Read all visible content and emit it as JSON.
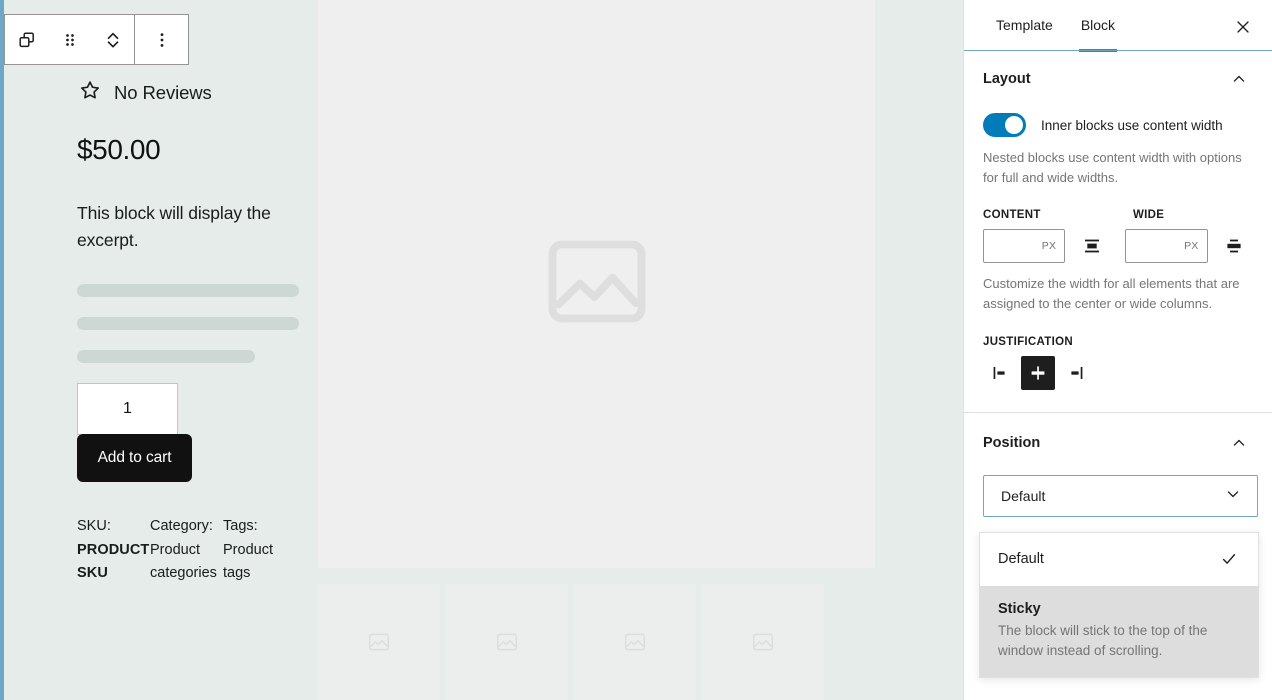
{
  "canvas": {
    "toolbar": {
      "group_icon": "group-blocks-icon",
      "drag_icon": "drag-handle-icon",
      "move_icon": "move-up-down-icon",
      "more_icon": "more-options-icon"
    },
    "product": {
      "reviews_icon": "star-outline-icon",
      "reviews_label": "No Reviews",
      "price": "$50.00",
      "excerpt": "This block will display the excerpt.",
      "quantity_value": "1",
      "add_to_cart_label": "Add to cart",
      "meta": [
        {
          "label": "SKU:",
          "value": "PRODUCT SKU"
        },
        {
          "label": "Category:",
          "value": "Product categories"
        },
        {
          "label": "Tags:",
          "value": "Product tags"
        }
      ]
    },
    "gallery": {
      "main_placeholder_icon": "image-placeholder-icon",
      "thumb_icon": "image-placeholder-icon",
      "thumb_count": 4
    }
  },
  "sidebar": {
    "tabs": [
      {
        "label": "Template",
        "active": false
      },
      {
        "label": "Block",
        "active": true
      }
    ],
    "close_icon": "close-icon",
    "layout": {
      "title": "Layout",
      "collapse_icon": "chevron-up-icon",
      "toggle_label": "Inner blocks use content width",
      "toggle_on": true,
      "help_text": "Nested blocks use content width with options for full and wide widths.",
      "content_label": "CONTENT",
      "wide_label": "WIDE",
      "content_value": "",
      "wide_value": "",
      "unit_suffix": "PX",
      "content_align_icon": "align-content-width-icon",
      "wide_align_icon": "align-wide-width-icon",
      "width_help_text": "Customize the width for all elements that are assigned to the center or wide columns.",
      "justification_label": "JUSTIFICATION",
      "justification_options": [
        {
          "icon": "justify-left-icon",
          "selected": false
        },
        {
          "icon": "justify-center-icon",
          "selected": true
        },
        {
          "icon": "justify-right-icon",
          "selected": false
        }
      ]
    },
    "position": {
      "title": "Position",
      "collapse_icon": "chevron-up-icon",
      "selected_value": "Default",
      "dropdown_icon": "chevron-down-icon",
      "options": [
        {
          "label": "Default",
          "description": "",
          "checked": true,
          "highlighted": false,
          "check_icon": "checkmark-icon"
        },
        {
          "label": "Sticky",
          "description": "The block will stick to the top of the window instead of scrolling.",
          "checked": false,
          "highlighted": true
        }
      ]
    }
  },
  "colors": {
    "canvas_bg": "#e5ecea",
    "image_bg": "#efefef",
    "accent_blue": "#007cba",
    "tab_active": "#1e8cbe",
    "selection_border": "#6ea8c7",
    "button_black": "#111111",
    "skeleton": "#cdd8d4"
  }
}
